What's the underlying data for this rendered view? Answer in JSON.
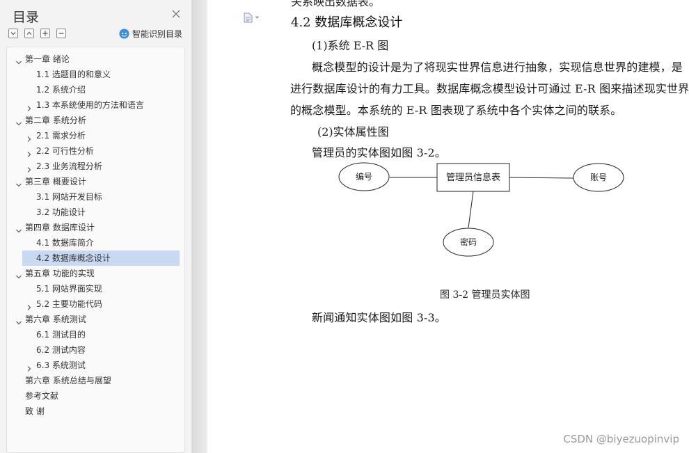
{
  "sidebar": {
    "title": "目录",
    "ai_label": "智能识别目录",
    "items": [
      {
        "label": "第一章  绪论",
        "level": 1,
        "chevron": "down"
      },
      {
        "label": "1.1  选题目的和意义",
        "level": 2,
        "chevron": "none"
      },
      {
        "label": "1.2  系统介绍",
        "level": 2,
        "chevron": "none"
      },
      {
        "label": "1.3    本系统使用的方法和语言",
        "level": 2,
        "chevron": "right"
      },
      {
        "label": "第二章  系统分析",
        "level": 1,
        "chevron": "down"
      },
      {
        "label": "2.1 需求分析",
        "level": 2,
        "chevron": "right"
      },
      {
        "label": "2.2 可行性分析",
        "level": 2,
        "chevron": "right"
      },
      {
        "label": "2.3  业务流程分析",
        "level": 2,
        "chevron": "right"
      },
      {
        "label": "第三章  概要设计",
        "level": 1,
        "chevron": "down"
      },
      {
        "label": "3.1 网站开发目标",
        "level": 2,
        "chevron": "none"
      },
      {
        "label": "3.2 功能设计",
        "level": 2,
        "chevron": "none"
      },
      {
        "label": "第四章  数据库设计",
        "level": 1,
        "chevron": "down"
      },
      {
        "label": "4.1 数据库简介",
        "level": 2,
        "chevron": "none"
      },
      {
        "label": "4.2 数据库概念设计",
        "level": 2,
        "chevron": "none",
        "active": true
      },
      {
        "label": "第五章  功能的实现",
        "level": 1,
        "chevron": "down"
      },
      {
        "label": "5.1  网站界面实现",
        "level": 2,
        "chevron": "none"
      },
      {
        "label": "5.2  主要功能代码",
        "level": 2,
        "chevron": "right"
      },
      {
        "label": "第六章  系统测试",
        "level": 1,
        "chevron": "down"
      },
      {
        "label": "6.1  测试目的",
        "level": 2,
        "chevron": "none"
      },
      {
        "label": "6.2  测试内容",
        "level": 2,
        "chevron": "none"
      },
      {
        "label": "6.3  系统测试",
        "level": 2,
        "chevron": "right"
      },
      {
        "label": "第六章  系统总结与展望",
        "level": 1,
        "chevron": "none"
      },
      {
        "label": "参考文献",
        "level": 1,
        "chevron": "none"
      },
      {
        "label": "致    谢",
        "level": 1,
        "chevron": "none"
      }
    ]
  },
  "document": {
    "cut_line": "关系映出数据表。",
    "heading": "4.2 数据库概念设计",
    "sub1": "(1)系统 E-R 图",
    "para1": [
      "概念模型的设计是为了将现实世界信息进行抽象，实现信息世界的建模，是",
      "进行数据库设计的有力工具。数据库概念模型设计可通过 E-R 图来描述现实世界",
      "的概念模型。本系统的 E-R 图表现了系统中各个实体之间的联系。"
    ],
    "sub2": "(2)实体属性图",
    "para2": "管理员的实体图如图 3-2。",
    "er": {
      "entity": "管理员信息表",
      "attr_left": "编号",
      "attr_right": "账号",
      "attr_bottom": "密码"
    },
    "caption": "图 3-2 管理员实体图",
    "para3": "新闻通知实体图如图 3-3。"
  },
  "watermark": "CSDN @biyezuopinvip"
}
